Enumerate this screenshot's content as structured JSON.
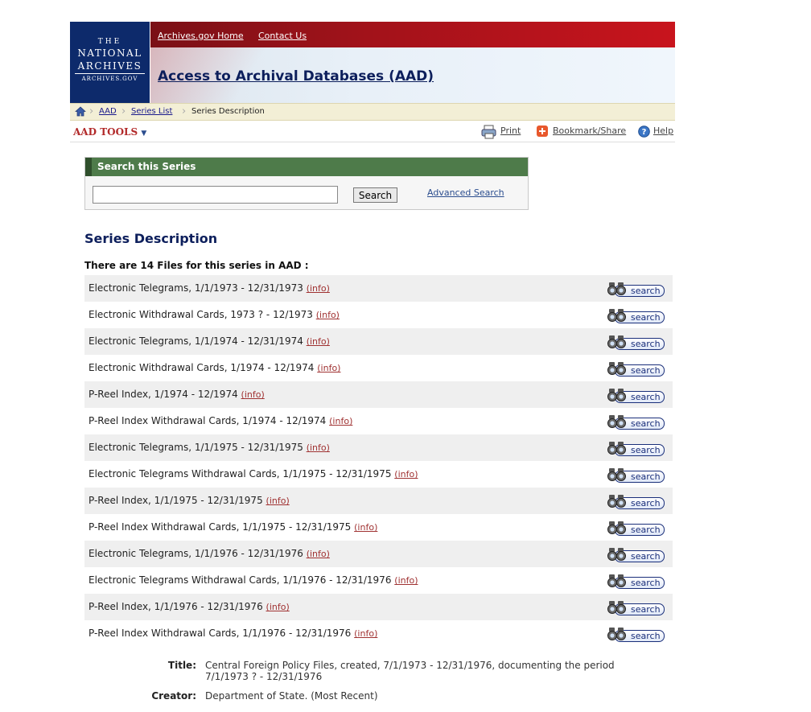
{
  "header": {
    "logo": {
      "line1": "THE",
      "line2": "NATIONAL",
      "line3": "ARCHIVES",
      "line4": "ARCHIVES.GOV"
    },
    "top_links": [
      "Archives.gov Home",
      "Contact Us"
    ],
    "app_title": "Access to Archival Databases (AAD)"
  },
  "breadcrumb": {
    "items": [
      "AAD",
      "Series List",
      "Series Description"
    ]
  },
  "toolbar": {
    "aad_tools": "AAD TOOLS",
    "aad_tools_arrow": "▼",
    "print": "Print",
    "bookmark": "Bookmark/Share",
    "help": "Help"
  },
  "search": {
    "heading": "Search this Series",
    "input_value": "",
    "button": "Search",
    "advanced": "Advanced Search"
  },
  "main": {
    "section_title": "Series Description",
    "files_count": "There are 14 Files for this series in AAD :",
    "info_label": "(info)",
    "search_label": "search",
    "files": [
      "Electronic Telegrams, 1/1/1973 - 12/31/1973",
      "Electronic Withdrawal Cards, 1973 ? - 12/1973",
      "Electronic Telegrams, 1/1/1974 - 12/31/1974",
      "Electronic Withdrawal Cards, 1/1974 - 12/1974",
      "P-Reel Index, 1/1974 - 12/1974",
      "P-Reel Index Withdrawal Cards, 1/1974 - 12/1974",
      "Electronic Telegrams, 1/1/1975 - 12/31/1975",
      "Electronic Telegrams Withdrawal Cards, 1/1/1975 - 12/31/1975",
      "P-Reel Index, 1/1/1975 - 12/31/1975",
      "P-Reel Index Withdrawal Cards, 1/1/1975 - 12/31/1975",
      "Electronic Telegrams, 1/1/1976 - 12/31/1976",
      "Electronic Telegrams Withdrawal Cards, 1/1/1976 - 12/31/1976",
      "P-Reel Index, 1/1/1976 - 12/31/1976",
      "P-Reel Index Withdrawal Cards, 1/1/1976 - 12/31/1976"
    ]
  },
  "meta": {
    "title_label": "Title:",
    "title_value_line1": "Central Foreign Policy Files, created, 7/1/1973 - 12/31/1976, documenting the period",
    "title_value_line2": "7/1/1973 ? - 12/31/1976",
    "creator_label": "Creator:",
    "creator_value": "Department of State. (Most Recent)"
  },
  "colors": {
    "banner_red": "#c8141d",
    "logo_blue": "#0d2a6b",
    "search_green": "#4e7b4a",
    "title_navy": "#0d1f5c",
    "info_red": "#a03232"
  }
}
